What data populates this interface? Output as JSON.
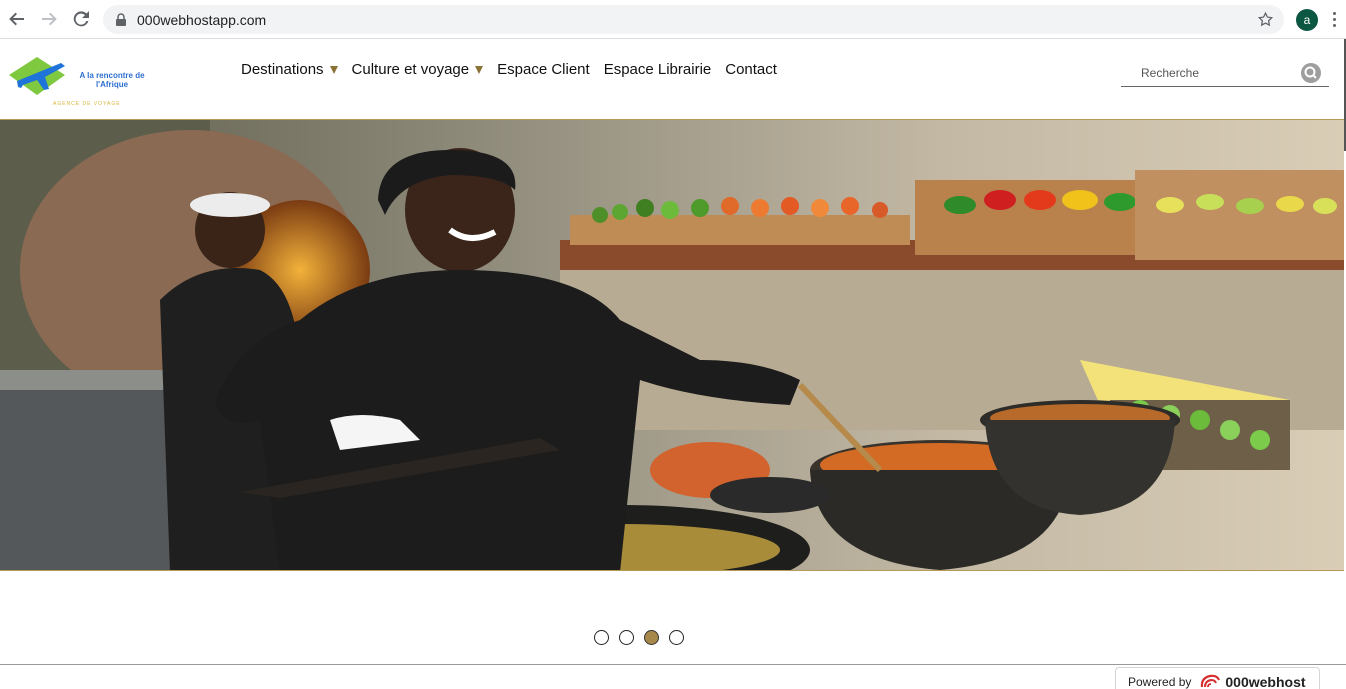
{
  "browser": {
    "url": "000webhostapp.com",
    "profile_initial": "a"
  },
  "site": {
    "logo_text": "A la rencontre de l'Afrique",
    "logo_subtext": "AGENCE DE VOYAGE",
    "menu": [
      {
        "label": "Destinations",
        "has_dropdown": true
      },
      {
        "label": "Culture et voyage",
        "has_dropdown": true
      },
      {
        "label": "Espace Client",
        "has_dropdown": false
      },
      {
        "label": "Espace Librairie",
        "has_dropdown": false
      },
      {
        "label": "Contact",
        "has_dropdown": false
      }
    ],
    "search_placeholder": "Recherche"
  },
  "carousel": {
    "slide_count": 4,
    "active_index": 2
  },
  "footer": {
    "powered_by": "Powered by",
    "brand": "000webhost"
  },
  "colors": {
    "accent": "#a6884a",
    "caret": "#8b7338"
  }
}
